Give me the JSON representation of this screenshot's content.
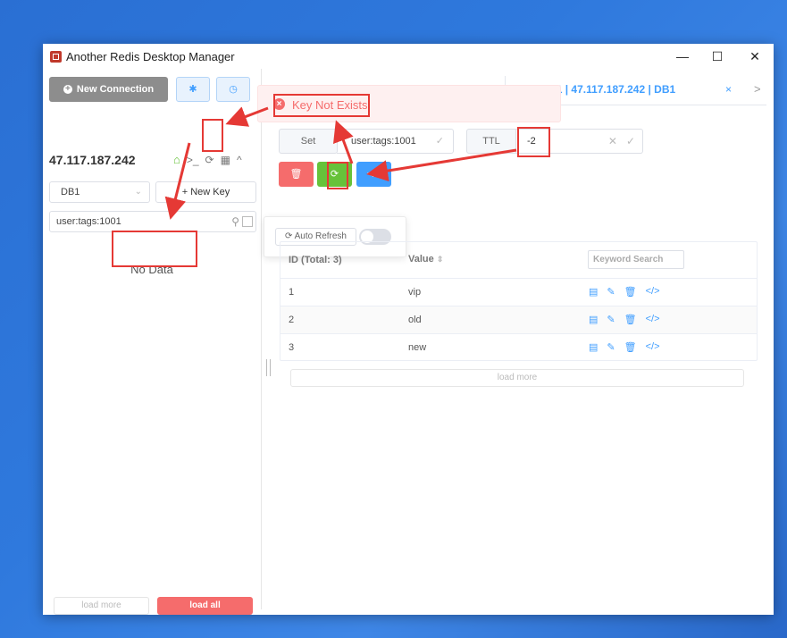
{
  "window": {
    "title": "Another Redis Desktop Manager",
    "controls": {
      "minimize": "—",
      "maximize": "☐",
      "close": "✕"
    }
  },
  "sidebar": {
    "new_connection_label": "New Connection",
    "new_connection_icon": "+",
    "settings_icon_glyph": "✱",
    "history_icon_glyph": "◷",
    "host": "47.117.187.242",
    "host_icons": {
      "home": "⌂",
      "terminal": ">_",
      "refresh": "⟳",
      "grid": "▦",
      "collapse": "^"
    },
    "db_select": "DB1",
    "new_key_label": "+ New Key",
    "key_filter_value": "user:tags:1001",
    "no_data": "No Data",
    "load_more": "load more",
    "load_all": "load all"
  },
  "tab": {
    "label": "tags:1001 | 47.117.187.242 | DB1",
    "close": "×",
    "next": ">"
  },
  "message": {
    "icon": "×",
    "text": "Key Not Exists"
  },
  "key_header": {
    "type": "Set",
    "key_name": "user:tags:1001",
    "confirm_glyph": "✓",
    "ttl_label": "TTL",
    "ttl_value": "-2",
    "ttl_clear": "✕",
    "ttl_confirm": "✓"
  },
  "actions": {
    "delete_icon": "🗑",
    "refresh_icon": "⟳",
    "code_icon": "</>"
  },
  "auto_refresh": {
    "label": "Auto Refresh",
    "icon": "⟳",
    "enabled": false
  },
  "table": {
    "columns": {
      "id": "ID (Total: 3)",
      "value": "Value",
      "sort": "⇕"
    },
    "search_placeholder": "Keyword Search",
    "rows": [
      {
        "id": "1",
        "value": "vip"
      },
      {
        "id": "2",
        "value": "old"
      },
      {
        "id": "3",
        "value": "new"
      }
    ],
    "row_action_icons": {
      "view": "▤",
      "edit": "✎",
      "delete": "🗑",
      "code": "</>"
    },
    "load_more": "load more"
  },
  "colors": {
    "danger": "#f56c6c",
    "success": "#67c23a",
    "primary": "#409eff",
    "annotation": "#e53935",
    "desktop": "#2f79dd"
  }
}
